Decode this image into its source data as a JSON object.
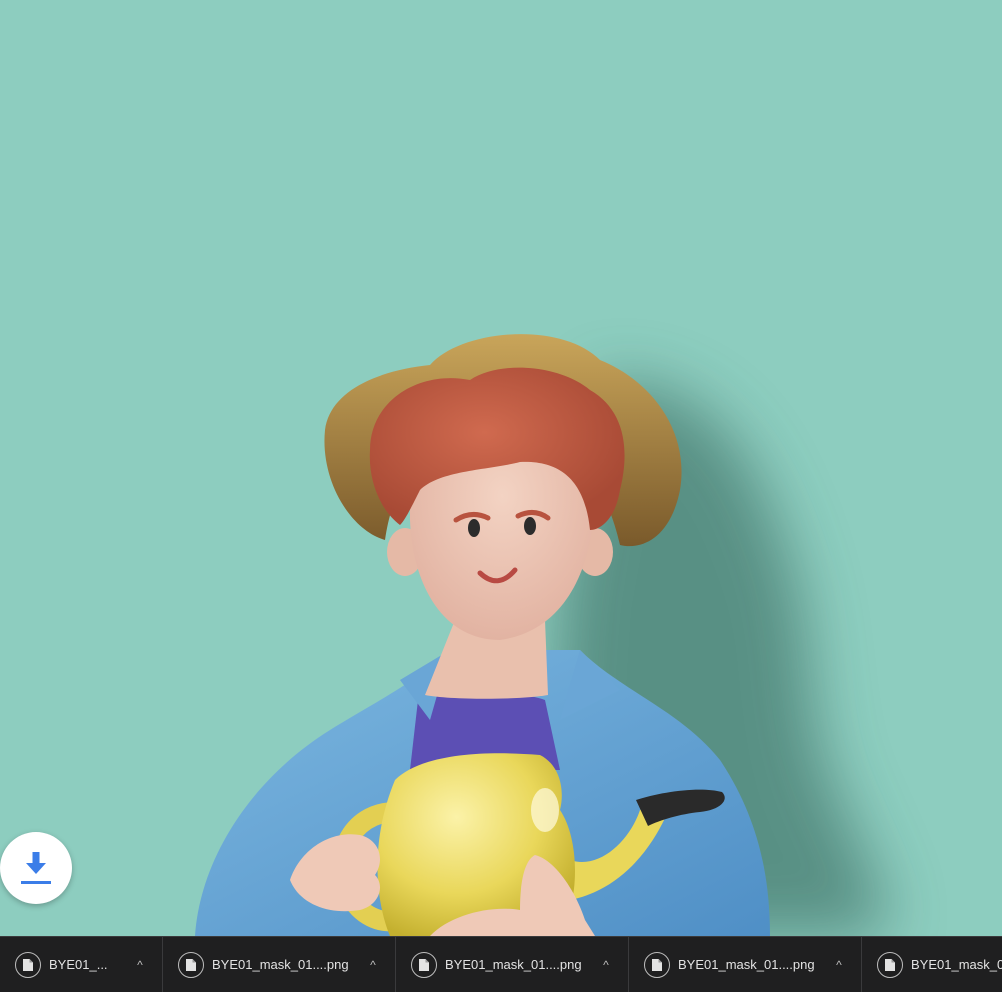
{
  "background_color": "#8dcdbf",
  "fab": {
    "icon": "download-icon",
    "accent_color": "#3b7de8"
  },
  "downloads_bar": {
    "items": [
      {
        "name": "BYE01_...",
        "icon": "file-icon",
        "caret": "^"
      },
      {
        "name": "BYE01_mask_01....png",
        "icon": "file-icon",
        "caret": "^"
      },
      {
        "name": "BYE01_mask_01....png",
        "icon": "file-icon",
        "caret": "^"
      },
      {
        "name": "BYE01_mask_01....png",
        "icon": "file-icon",
        "caret": "^"
      },
      {
        "name": "BYE01_mask_0",
        "icon": "file-icon",
        "caret": ""
      }
    ]
  }
}
